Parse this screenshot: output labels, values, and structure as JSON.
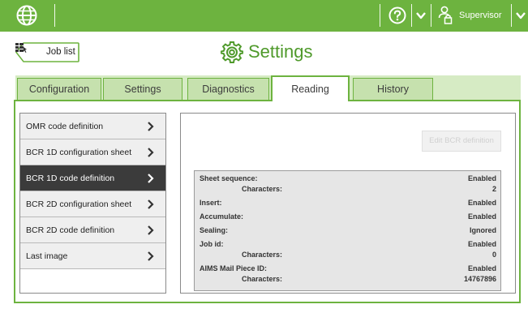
{
  "topbar": {
    "brand_color": "#6db33f",
    "help_icon": "question-circle-icon",
    "user_label": "Supervisor"
  },
  "header": {
    "job_list_label": "Job list",
    "title": "Settings"
  },
  "tabs": [
    {
      "label": "Configuration",
      "active": false
    },
    {
      "label": "Settings",
      "active": false
    },
    {
      "label": "Diagnostics",
      "active": false
    },
    {
      "label": "Reading",
      "active": true
    },
    {
      "label": "History",
      "active": false
    }
  ],
  "menu": {
    "items": [
      {
        "label": "OMR code definition",
        "selected": false
      },
      {
        "label": "BCR 1D configuration sheet",
        "selected": false
      },
      {
        "label": "BCR 1D code definition",
        "selected": true
      },
      {
        "label": "BCR 2D configuration sheet",
        "selected": false
      },
      {
        "label": "BCR 2D code definition",
        "selected": false
      },
      {
        "label": "Last image",
        "selected": false
      }
    ]
  },
  "panel": {
    "edit_button_label": "Edit BCR definition",
    "rows": [
      {
        "key": "Sheet sequence:",
        "value": "Enabled"
      },
      {
        "key": "Characters:",
        "value": "2"
      },
      {
        "key": "Insert:",
        "value": "Enabled"
      },
      {
        "key": "Accumulate:",
        "value": "Enabled"
      },
      {
        "key": "Sealing:",
        "value": "Ignored"
      },
      {
        "key": "Job id:",
        "value": "Enabled"
      },
      {
        "key": "Characters:",
        "value": "0"
      },
      {
        "key": "AIMS Mail Piece ID:",
        "value": "Enabled"
      },
      {
        "key": "Characters:",
        "value": "14767896"
      }
    ]
  }
}
